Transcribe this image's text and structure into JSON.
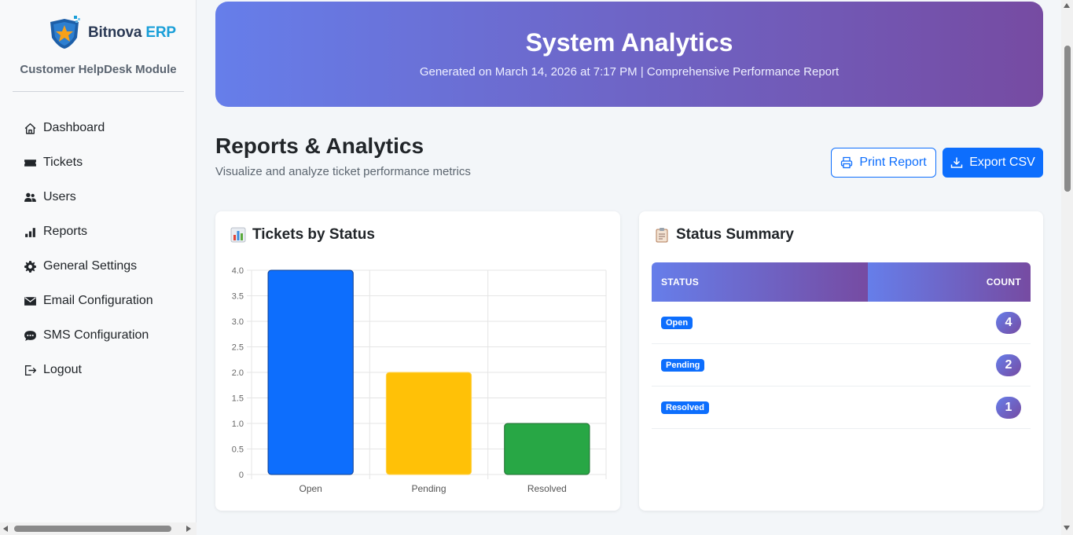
{
  "sidebar": {
    "brand_name": "Bitnova",
    "brand_suffix": "ERP",
    "module_title": "Customer HelpDesk Module",
    "items": [
      {
        "label": "Dashboard",
        "icon": "home-icon"
      },
      {
        "label": "Tickets",
        "icon": "ticket-icon"
      },
      {
        "label": "Users",
        "icon": "users-icon"
      },
      {
        "label": "Reports",
        "icon": "bar-chart-icon"
      },
      {
        "label": "General Settings",
        "icon": "gear-icon"
      },
      {
        "label": "Email Configuration",
        "icon": "envelope-icon"
      },
      {
        "label": "SMS Configuration",
        "icon": "chat-icon"
      },
      {
        "label": "Logout",
        "icon": "logout-icon"
      }
    ]
  },
  "banner": {
    "title": "System Analytics",
    "subtitle": "Generated on March 14, 2026 at 7:17 PM | Comprehensive Performance Report"
  },
  "header": {
    "title": "Reports & Analytics",
    "subtitle": "Visualize and analyze ticket performance metrics",
    "print_label": "Print Report",
    "export_label": "Export CSV"
  },
  "chart_card": {
    "title": "Tickets by Status",
    "icon": "bar-chart-emoji-icon"
  },
  "summary_card": {
    "title": "Status Summary",
    "icon": "clipboard-icon",
    "columns": [
      "STATUS",
      "COUNT"
    ],
    "rows": [
      {
        "status": "Open",
        "count": "4"
      },
      {
        "status": "Pending",
        "count": "2"
      },
      {
        "status": "Resolved",
        "count": "1"
      }
    ]
  },
  "colors": {
    "primary": "#0d6efd",
    "gradient_start": "#667eea",
    "gradient_end": "#764ba2",
    "open": "#0d6efd",
    "pending": "#ffc107",
    "resolved": "#28a745"
  },
  "chart_data": {
    "type": "bar",
    "categories": [
      "Open",
      "Pending",
      "Resolved"
    ],
    "values": [
      4,
      2,
      1
    ],
    "colors": [
      "#0d6efd",
      "#ffc107",
      "#28a745"
    ],
    "yticks": [
      "0",
      "0.5",
      "1.0",
      "1.5",
      "2.0",
      "2.5",
      "3.0",
      "3.5",
      "4.0"
    ],
    "ylim": [
      0,
      4
    ],
    "grid": true,
    "legend": "none"
  }
}
